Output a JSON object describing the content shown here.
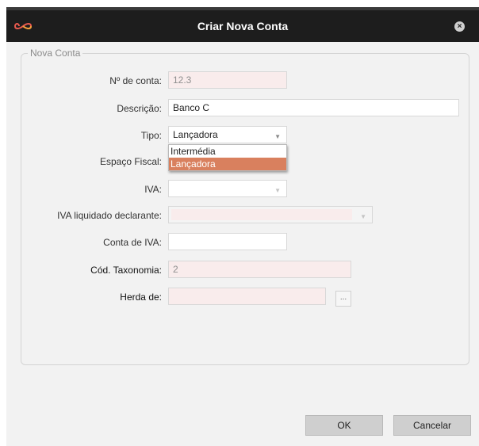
{
  "window": {
    "title": "Criar Nova Conta",
    "close_icon": "close-icon",
    "logo_icon": "infinity-logo-icon",
    "logo_color": "#e85a4f"
  },
  "group": {
    "legend": "Nova Conta"
  },
  "form": {
    "numero_conta": {
      "label": "Nº de conta:",
      "value": "12.3"
    },
    "descricao": {
      "label": "Descrição:",
      "value": "Banco C"
    },
    "tipo": {
      "label": "Tipo:",
      "value": "Lançadora",
      "options": [
        "Intermédia",
        "Lançadora"
      ],
      "highlighted": "Lançadora"
    },
    "espaco_fiscal": {
      "label": "Espaço Fiscal:"
    },
    "iva": {
      "label": "IVA:",
      "value": ""
    },
    "iva_liquidado": {
      "label": "IVA liquidado declarante:",
      "value": ""
    },
    "conta_iva": {
      "label": "Conta de IVA:",
      "value": ""
    },
    "cod_taxonomia": {
      "label": "Cód. Taxonomia:",
      "value": "2"
    },
    "herda_de": {
      "label": "Herda de:",
      "value": "",
      "browse_label": "..."
    }
  },
  "buttons": {
    "ok": "OK",
    "cancel": "Cancelar"
  },
  "colors": {
    "accent": "#d9805e",
    "readonly_bg": "#f9ecec",
    "titlebar": "#1d1d1d"
  }
}
